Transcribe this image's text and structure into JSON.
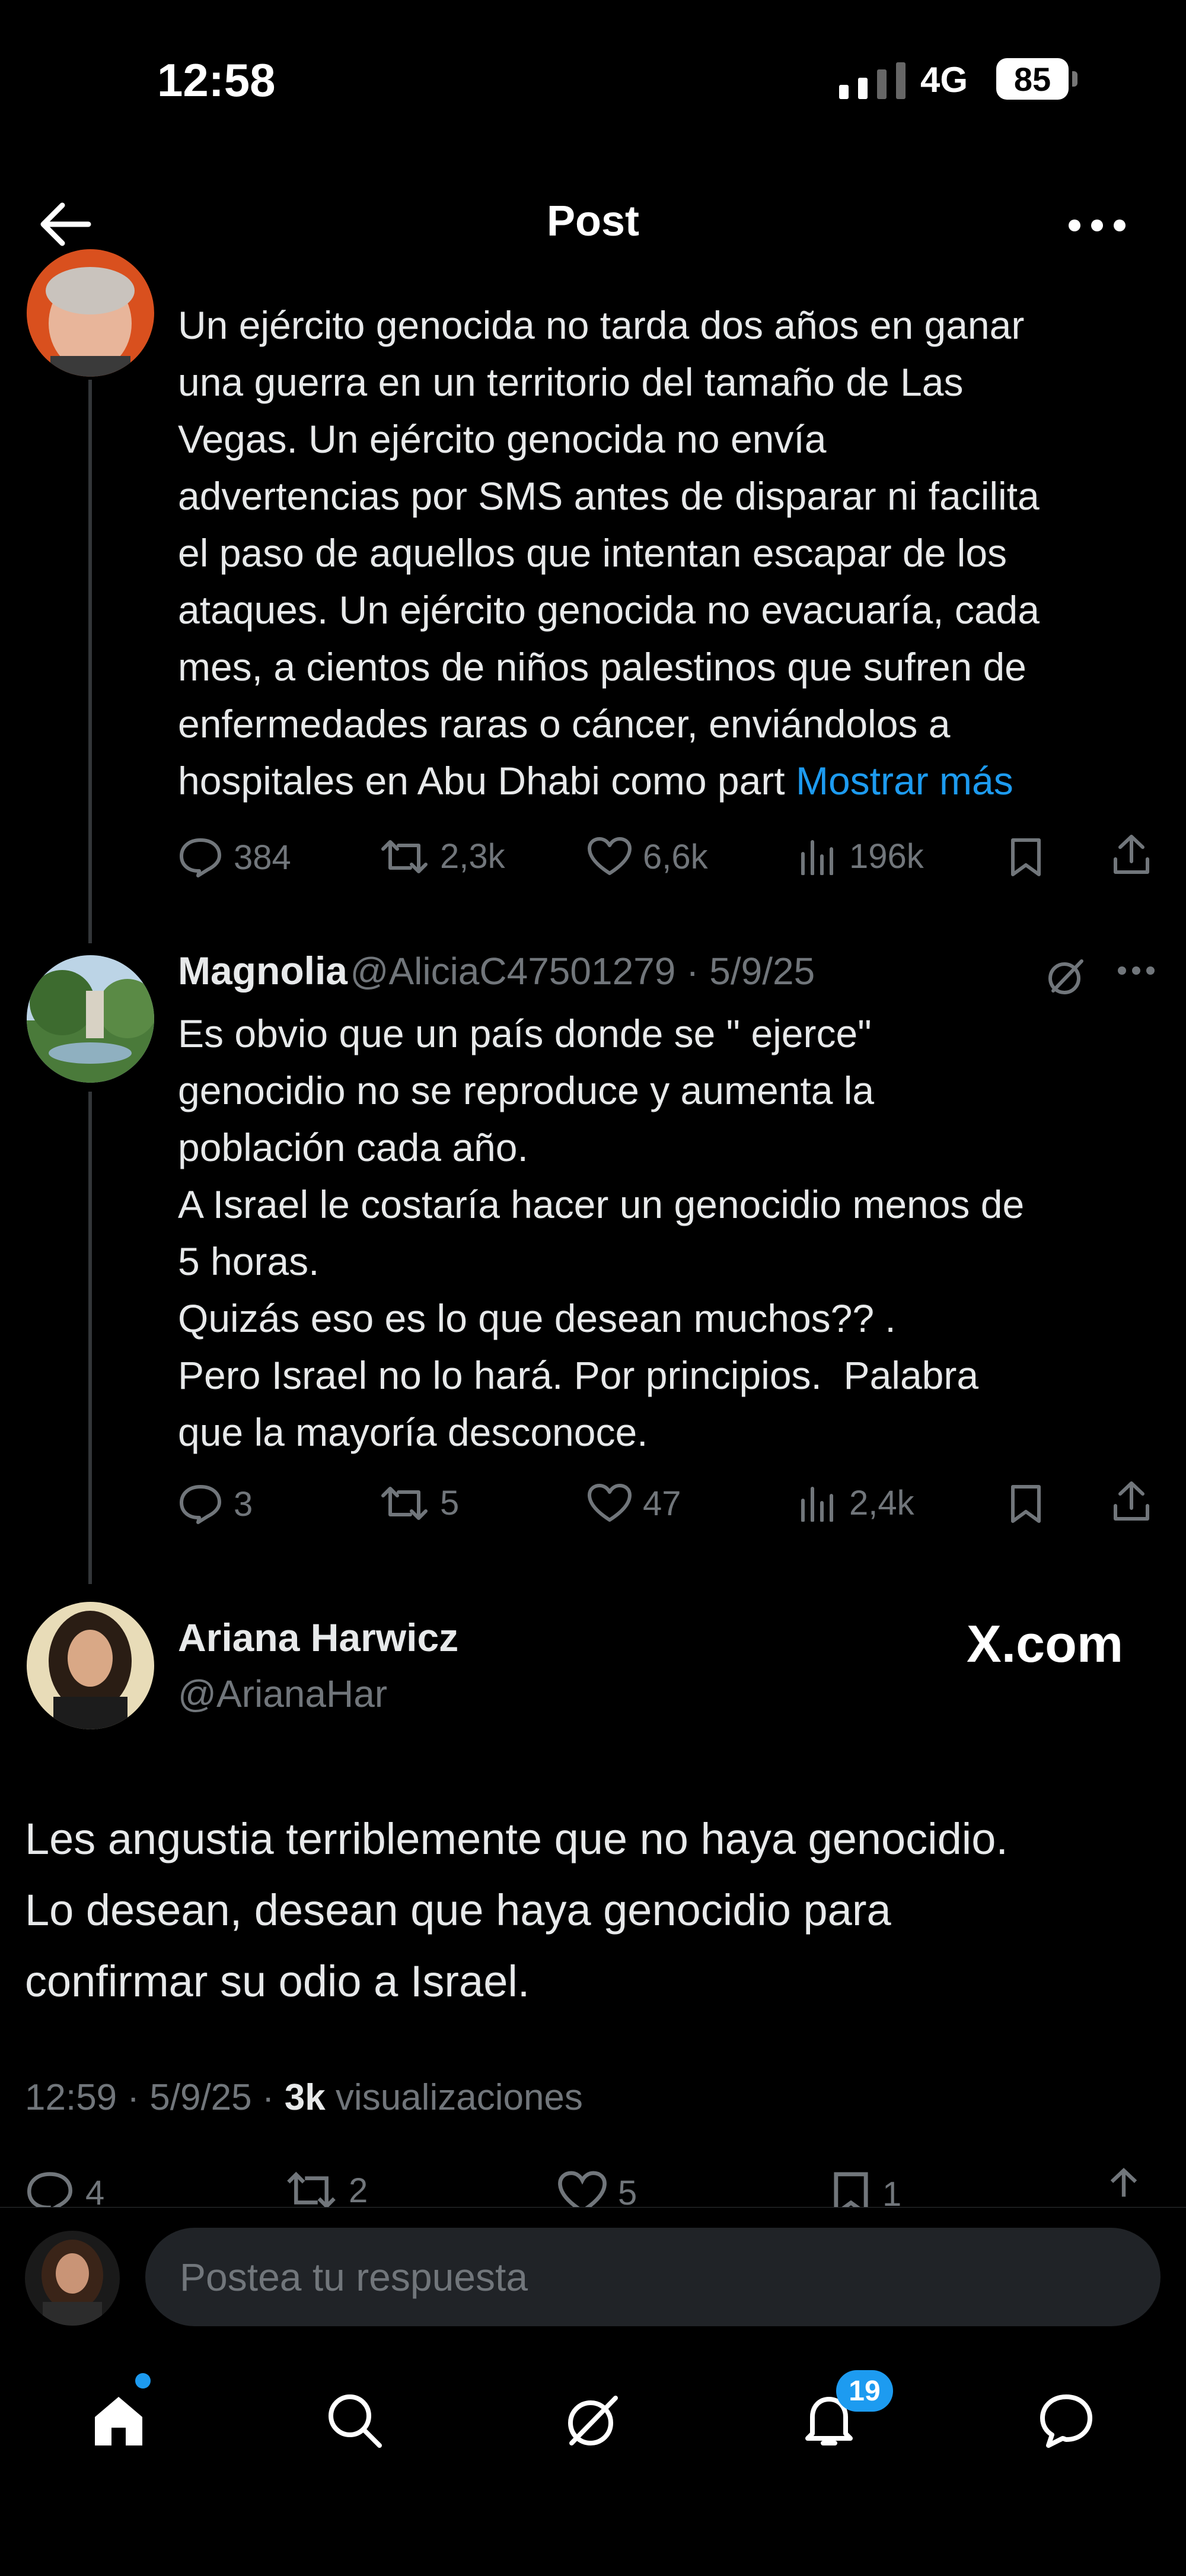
{
  "status_bar": {
    "time": "12:58",
    "network": "4G",
    "battery": "85"
  },
  "header": {
    "title": "Post"
  },
  "tweet1": {
    "text": "Un ejército genocida no tarda dos años en ganar\nuna guerra en un territorio del tamaño de Las\nVegas. Un ejército genocida no envía\nadvertencias por SMS antes de disparar ni facilita\nel paso de aquellos que intentan escapar de los\nataques. Un ejército genocida no evacuaría, cada\nmes, a cientos de niños palestinos que sufren de\nenfermedades raras o cáncer, enviándolos a\nhospitales en Abu Dhabi como part ",
    "show_more": "Mostrar más",
    "metrics": {
      "replies": "384",
      "reposts": "2,3k",
      "likes": "6,6k",
      "views": "196k"
    }
  },
  "tweet2": {
    "name": "Magnolia",
    "handle_date": "@AliciaC47501279 · 5/9/25",
    "text": "Es obvio que un país donde se \" ejerce\"\ngenocidio no se reproduce y aumenta la\npoblación cada año.\nA Israel le costaría hacer un genocidio menos de\n5 horas.\nQuizás eso es lo que desean muchos?? .\nPero Israel no lo hará. Por principios.  Palabra\nque la mayoría desconoce.",
    "metrics": {
      "replies": "3",
      "reposts": "5",
      "likes": "47",
      "views": "2,4k"
    }
  },
  "main_tweet": {
    "name": "Ariana Harwicz",
    "handle": "@ArianaHar",
    "watermark": "X.com",
    "text": "Les angustia terriblemente que no haya genocidio.\nLo desean, desean que haya genocidio para\nconfirmar su odio a Israel.",
    "time_date": "12:59 · 5/9/25 · ",
    "views_count": "3k",
    "views_label": " visualizaciones",
    "metrics": {
      "replies": "4",
      "reposts": "2",
      "likes": "5",
      "bookmarks": "1"
    }
  },
  "reply": {
    "placeholder": "Postea tu respuesta"
  },
  "bottom_nav": {
    "notifications_count": "19"
  },
  "icons": [
    "back-arrow-icon",
    "more-icon",
    "reply-icon",
    "repost-icon",
    "like-icon",
    "views-icon",
    "bookmark-icon",
    "share-icon",
    "grok-icon",
    "home-icon",
    "search-icon",
    "notifications-icon",
    "messages-icon"
  ],
  "colors": {
    "background": "#000000",
    "accent": "#1d9bf0",
    "text": "#e7e9ea",
    "muted": "#71767b"
  }
}
